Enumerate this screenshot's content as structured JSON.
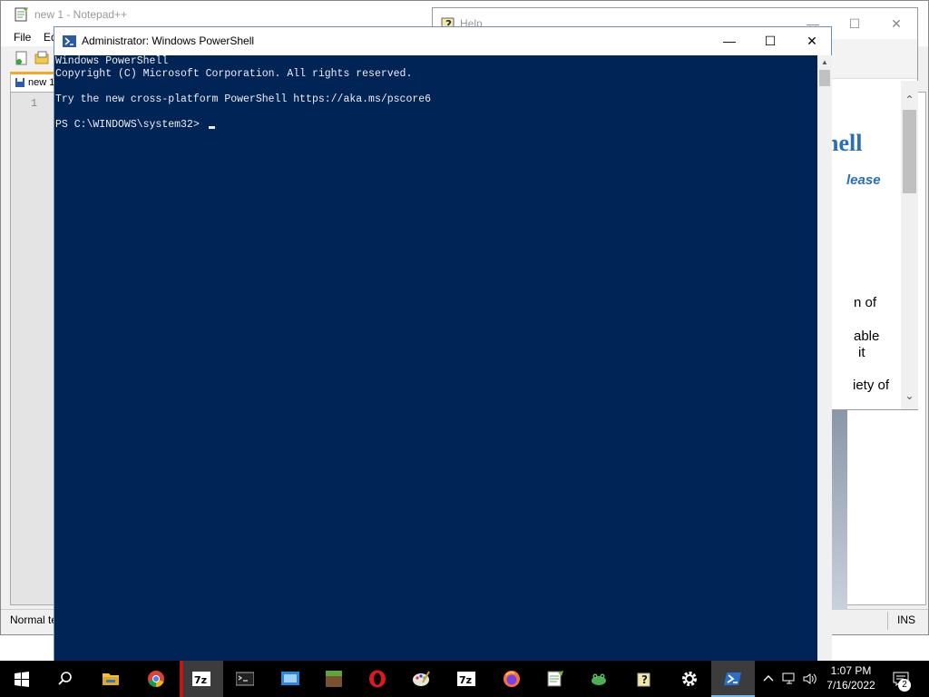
{
  "notepad": {
    "title": "new 1 - Notepad++",
    "menu": [
      "File",
      "Ed"
    ],
    "tab_label": "new 1",
    "line_number": "1",
    "status_left": "Normal te",
    "status_right": "INS"
  },
  "help": {
    "title": "Help",
    "heading_fragment": "hell",
    "subtitle_fragment": "lease",
    "text_lines": [
      "n of",
      "able",
      "it",
      "iety of"
    ]
  },
  "powershell": {
    "title": "Administrator: Windows PowerShell",
    "lines": [
      "Windows PowerShell",
      "Copyright (C) Microsoft Corporation. All rights reserved.",
      "",
      "Try the new cross-platform PowerShell https://aka.ms/pscore6",
      "",
      "PS C:\\WINDOWS\\system32> "
    ],
    "console_bg": "#012456"
  },
  "taskbar": {
    "apps": [
      "start",
      "search",
      "file-explorer",
      "chrome",
      "7zip",
      "command-prompt",
      "remote-desktop",
      "minecraft",
      "opera",
      "paint",
      "7zip-2",
      "firefox",
      "notepad-plus-plus",
      "frog-app",
      "help",
      "settings",
      "powershell"
    ],
    "time": "1:07 PM",
    "date": "7/16/2022",
    "notifications_count": "2"
  }
}
